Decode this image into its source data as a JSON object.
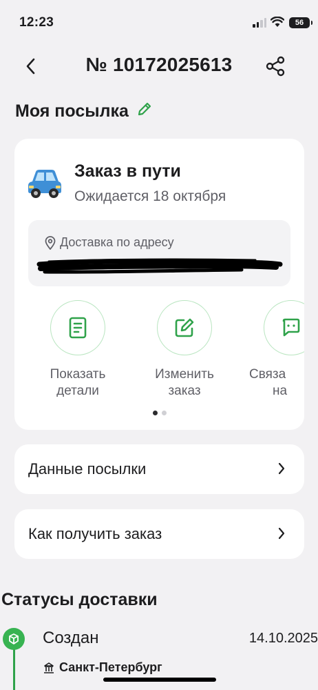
{
  "status_bar": {
    "time": "12:23",
    "battery": "56"
  },
  "header": {
    "order_number": "№ 10172025613"
  },
  "section": {
    "title": "Моя посылка"
  },
  "order_card": {
    "status_title": "Заказ в пути",
    "expected": "Ожидается 18 октября",
    "delivery_label": "Доставка по адресу",
    "actions": [
      {
        "label_line1": "Показать",
        "label_line2": "детали",
        "icon": "document-icon"
      },
      {
        "label_line1": "Изменить",
        "label_line2": "заказ",
        "icon": "edit-icon"
      },
      {
        "label_line1": "Связа",
        "label_line2": "на",
        "icon": "chat-icon"
      }
    ],
    "carousel_pages": 2,
    "carousel_active": 1
  },
  "rows": [
    {
      "label": "Данные посылки"
    },
    {
      "label": "Как получить заказ"
    }
  ],
  "statuses": {
    "title": "Статусы доставки",
    "items": [
      {
        "status": "Создан",
        "date": "14.10.2025",
        "city": "Санкт-Петербург"
      }
    ]
  },
  "colors": {
    "accent": "#2fa24a",
    "background": "#f2f1f3",
    "card": "#ffffff"
  }
}
